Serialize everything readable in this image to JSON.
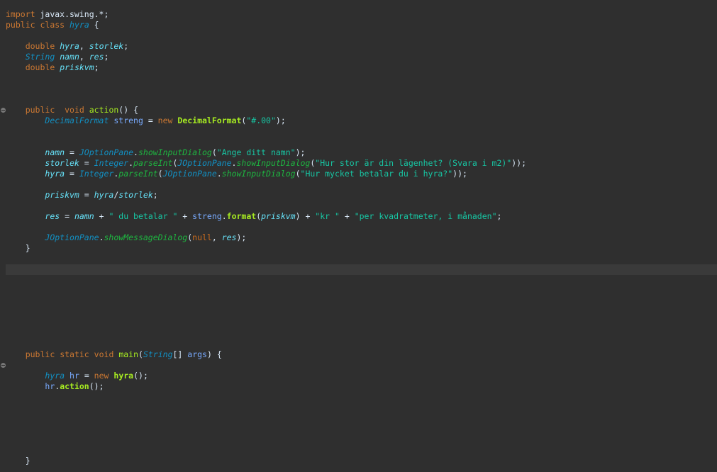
{
  "editor": {
    "lines": [
      [
        {
          "t": "import",
          "c": "kw"
        },
        {
          "t": " javax.swing.*;",
          "c": "plain"
        }
      ],
      [
        {
          "t": "public",
          "c": "kw"
        },
        {
          "t": " ",
          "c": "plain"
        },
        {
          "t": "class",
          "c": "kw"
        },
        {
          "t": " ",
          "c": "plain"
        },
        {
          "t": "hyra",
          "c": "type"
        },
        {
          "t": " {",
          "c": "plain"
        }
      ],
      [],
      [
        {
          "t": "    ",
          "c": "plain"
        },
        {
          "t": "double",
          "c": "kw"
        },
        {
          "t": " ",
          "c": "plain"
        },
        {
          "t": "hyra",
          "c": "field"
        },
        {
          "t": ", ",
          "c": "plain"
        },
        {
          "t": "storlek",
          "c": "field"
        },
        {
          "t": ";",
          "c": "plain"
        }
      ],
      [
        {
          "t": "    ",
          "c": "plain"
        },
        {
          "t": "String",
          "c": "type"
        },
        {
          "t": " ",
          "c": "plain"
        },
        {
          "t": "namn",
          "c": "field"
        },
        {
          "t": ", ",
          "c": "plain"
        },
        {
          "t": "res",
          "c": "field"
        },
        {
          "t": ";",
          "c": "plain"
        }
      ],
      [
        {
          "t": "    ",
          "c": "plain"
        },
        {
          "t": "double",
          "c": "kw"
        },
        {
          "t": " ",
          "c": "plain"
        },
        {
          "t": "priskvm",
          "c": "field"
        },
        {
          "t": ";",
          "c": "plain"
        }
      ],
      [],
      [],
      [],
      [
        {
          "t": "    ",
          "c": "plain"
        },
        {
          "t": "public",
          "c": "kw"
        },
        {
          "t": "  ",
          "c": "plain"
        },
        {
          "t": "void",
          "c": "kw"
        },
        {
          "t": " ",
          "c": "plain"
        },
        {
          "t": "action",
          "c": "meth"
        },
        {
          "t": "() {",
          "c": "plain"
        }
      ],
      [
        {
          "t": "        ",
          "c": "plain"
        },
        {
          "t": "DecimalFormat",
          "c": "type"
        },
        {
          "t": " ",
          "c": "plain"
        },
        {
          "t": "streng",
          "c": "lv"
        },
        {
          "t": " = ",
          "c": "plain"
        },
        {
          "t": "new",
          "c": "kw"
        },
        {
          "t": " ",
          "c": "plain"
        },
        {
          "t": "DecimalFormat",
          "c": "meth bold"
        },
        {
          "t": "(",
          "c": "plain"
        },
        {
          "t": "\"#.00\"",
          "c": "str"
        },
        {
          "t": ");",
          "c": "plain"
        }
      ],
      [],
      [],
      [
        {
          "t": "        ",
          "c": "plain"
        },
        {
          "t": "namn",
          "c": "field"
        },
        {
          "t": " = ",
          "c": "plain"
        },
        {
          "t": "JOptionPane",
          "c": "type"
        },
        {
          "t": ".",
          "c": "plain"
        },
        {
          "t": "showInputDialog",
          "c": "methi"
        },
        {
          "t": "(",
          "c": "plain"
        },
        {
          "t": "\"Ange ditt namn\"",
          "c": "str"
        },
        {
          "t": ");",
          "c": "plain"
        }
      ],
      [
        {
          "t": "        ",
          "c": "plain"
        },
        {
          "t": "storlek",
          "c": "field"
        },
        {
          "t": " = ",
          "c": "plain"
        },
        {
          "t": "Integer",
          "c": "type"
        },
        {
          "t": ".",
          "c": "plain"
        },
        {
          "t": "parseInt",
          "c": "methi"
        },
        {
          "t": "(",
          "c": "plain"
        },
        {
          "t": "JOptionPane",
          "c": "type"
        },
        {
          "t": ".",
          "c": "plain"
        },
        {
          "t": "showInputDialog",
          "c": "methi"
        },
        {
          "t": "(",
          "c": "plain"
        },
        {
          "t": "\"Hur stor är din lägenhet? (Svara i m2)\"",
          "c": "str"
        },
        {
          "t": "));",
          "c": "plain"
        }
      ],
      [
        {
          "t": "        ",
          "c": "plain"
        },
        {
          "t": "hyra",
          "c": "field"
        },
        {
          "t": " = ",
          "c": "plain"
        },
        {
          "t": "Integer",
          "c": "type"
        },
        {
          "t": ".",
          "c": "plain"
        },
        {
          "t": "parseInt",
          "c": "methi"
        },
        {
          "t": "(",
          "c": "plain"
        },
        {
          "t": "JOptionPane",
          "c": "type"
        },
        {
          "t": ".",
          "c": "plain"
        },
        {
          "t": "showInputDialog",
          "c": "methi"
        },
        {
          "t": "(",
          "c": "plain"
        },
        {
          "t": "\"Hur mycket betalar du i hyra?\"",
          "c": "str"
        },
        {
          "t": "));",
          "c": "plain"
        }
      ],
      [],
      [
        {
          "t": "        ",
          "c": "plain"
        },
        {
          "t": "priskvm",
          "c": "field"
        },
        {
          "t": " = ",
          "c": "plain"
        },
        {
          "t": "hyra",
          "c": "field"
        },
        {
          "t": "/",
          "c": "plain"
        },
        {
          "t": "storlek",
          "c": "field"
        },
        {
          "t": ";",
          "c": "plain"
        }
      ],
      [],
      [
        {
          "t": "        ",
          "c": "plain"
        },
        {
          "t": "res",
          "c": "field"
        },
        {
          "t": " = ",
          "c": "plain"
        },
        {
          "t": "namn",
          "c": "field"
        },
        {
          "t": " + ",
          "c": "plain"
        },
        {
          "t": "\" du betalar \"",
          "c": "str"
        },
        {
          "t": " + ",
          "c": "plain"
        },
        {
          "t": "streng",
          "c": "lv"
        },
        {
          "t": ".",
          "c": "plain"
        },
        {
          "t": "format",
          "c": "meth bold"
        },
        {
          "t": "(",
          "c": "plain"
        },
        {
          "t": "priskvm",
          "c": "field"
        },
        {
          "t": ") + ",
          "c": "plain"
        },
        {
          "t": "\"kr \"",
          "c": "str"
        },
        {
          "t": " + ",
          "c": "plain"
        },
        {
          "t": "\"per kvadratmeter, i månaden\"",
          "c": "str"
        },
        {
          "t": ";",
          "c": "plain"
        }
      ],
      [],
      [
        {
          "t": "        ",
          "c": "plain"
        },
        {
          "t": "JOptionPane",
          "c": "type"
        },
        {
          "t": ".",
          "c": "plain"
        },
        {
          "t": "showMessageDialog",
          "c": "methi"
        },
        {
          "t": "(",
          "c": "plain"
        },
        {
          "t": "null",
          "c": "nul"
        },
        {
          "t": ", ",
          "c": "plain"
        },
        {
          "t": "res",
          "c": "field"
        },
        {
          "t": ");",
          "c": "plain"
        }
      ],
      [
        {
          "t": "    }",
          "c": "plain"
        }
      ],
      [],
      [],
      [],
      [],
      [],
      [],
      [],
      [],
      [],
      [
        {
          "t": "    ",
          "c": "plain"
        },
        {
          "t": "public",
          "c": "kw"
        },
        {
          "t": " ",
          "c": "plain"
        },
        {
          "t": "static",
          "c": "kw"
        },
        {
          "t": " ",
          "c": "plain"
        },
        {
          "t": "void",
          "c": "kw"
        },
        {
          "t": " ",
          "c": "plain"
        },
        {
          "t": "main",
          "c": "meth"
        },
        {
          "t": "(",
          "c": "plain"
        },
        {
          "t": "String",
          "c": "type"
        },
        {
          "t": "[] ",
          "c": "plain"
        },
        {
          "t": "args",
          "c": "lv"
        },
        {
          "t": ") {",
          "c": "plain"
        }
      ],
      [],
      [
        {
          "t": "        ",
          "c": "plain"
        },
        {
          "t": "hyra",
          "c": "type"
        },
        {
          "t": " ",
          "c": "plain"
        },
        {
          "t": "hr",
          "c": "lv"
        },
        {
          "t": " = ",
          "c": "plain"
        },
        {
          "t": "new",
          "c": "kw"
        },
        {
          "t": " ",
          "c": "plain"
        },
        {
          "t": "hyra",
          "c": "meth bold"
        },
        {
          "t": "();",
          "c": "plain"
        }
      ],
      [
        {
          "t": "        ",
          "c": "plain"
        },
        {
          "t": "hr",
          "c": "lv"
        },
        {
          "t": ".",
          "c": "plain"
        },
        {
          "t": "action",
          "c": "meth bold"
        },
        {
          "t": "();",
          "c": "plain"
        }
      ],
      [],
      [],
      [],
      [],
      [],
      [],
      [
        {
          "t": "    }",
          "c": "plain"
        }
      ]
    ],
    "current_line_index": 24,
    "fold_markers": [
      9,
      33
    ]
  }
}
